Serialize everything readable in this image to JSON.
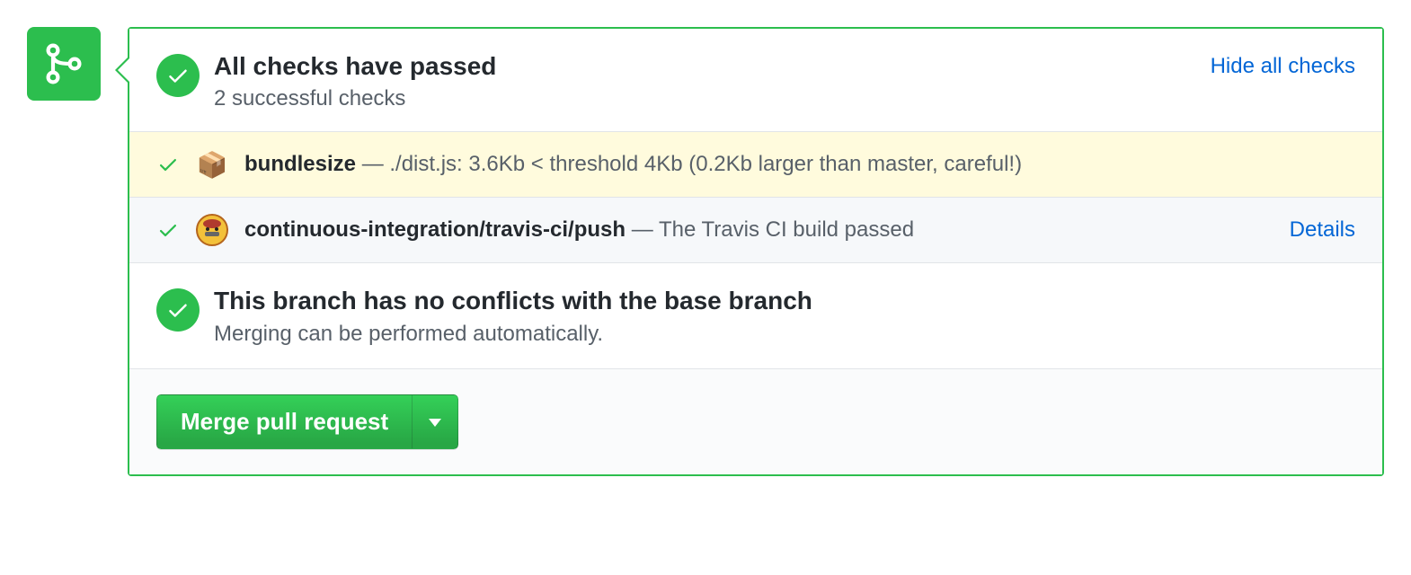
{
  "colors": {
    "success": "#2cbe4e",
    "link": "#0366d6"
  },
  "header": {
    "title": "All checks have passed",
    "subtitle": "2 successful checks",
    "toggle_label": "Hide all checks"
  },
  "checks": [
    {
      "status": "success",
      "icon": "package-icon",
      "context": "bundlesize",
      "sep": " — ",
      "description": "./dist.js: 3.6Kb < threshold 4Kb (0.2Kb larger than master, careful!)",
      "details_label": "",
      "highlight": true
    },
    {
      "status": "success",
      "icon": "travis-icon",
      "context": "continuous-integration/travis-ci/push",
      "sep": " — ",
      "description": "The Travis CI build passed",
      "details_label": "Details",
      "highlight": false
    }
  ],
  "mergeability": {
    "title": "This branch has no conflicts with the base branch",
    "subtitle": "Merging can be performed automatically."
  },
  "actions": {
    "merge_label": "Merge pull request"
  }
}
